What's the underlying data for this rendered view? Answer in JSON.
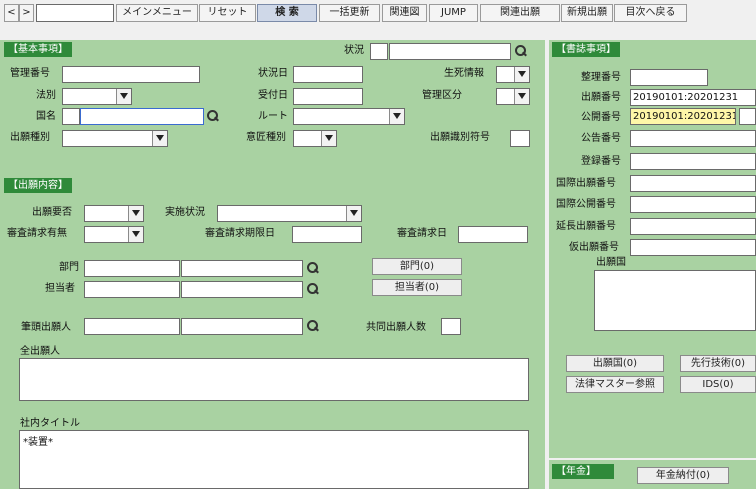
{
  "toolbar": {
    "prev": "<",
    "next": ">",
    "main_menu": "メインメニュー",
    "reset": "リセット",
    "search": "検 索",
    "bulk_update": "一括更新",
    "related_diagram": "関連図",
    "jump": "JUMP",
    "related_application": "関連出願",
    "new_application": "新規出願",
    "back_to_index": "目次へ戻る"
  },
  "basic": {
    "header": "【基本事項】",
    "status_label": "状況",
    "mgmt_no_label": "管理番号",
    "status_date_label": "状況日",
    "life_info_label": "生死情報",
    "law_label": "法別",
    "received_date_label": "受付日",
    "mgmt_class_label": "管理区分",
    "country_label": "国名",
    "route_label": "ルート",
    "app_type_label": "出願種別",
    "design_type_label": "意匠種別",
    "app_id_code_label": "出願識別符号"
  },
  "app": {
    "header": "【出願内容】",
    "app_needed_label": "出願要否",
    "impl_status_label": "実施状況",
    "exam_req_label": "審査請求有無",
    "exam_deadline_label": "審査請求期限日",
    "exam_date_label": "審査請求日",
    "dept_label": "部門",
    "dept_button": "部門(0)",
    "person_label": "担当者",
    "person_button": "担当者(0)",
    "lead_applicant_label": "筆頭出願人",
    "joint_count_label": "共同出願人数",
    "all_applicants_label": "全出願人",
    "internal_title_label": "社内タイトル",
    "internal_title_value": "*装置*"
  },
  "biblio": {
    "header": "【書誌事項】",
    "ref_no_label": "整理番号",
    "app_no_label": "出願番号",
    "app_no_value": "20190101:20201231",
    "pub_no_label": "公開番号",
    "pub_no_value": "20190101:20201231",
    "announce_no_label": "公告番号",
    "reg_no_label": "登録番号",
    "intl_app_no_label": "国際出願番号",
    "intl_pub_no_label": "国際公開番号",
    "ext_app_no_label": "延長出願番号",
    "prov_app_no_label": "仮出願番号",
    "app_country_label": "出願国",
    "app_country_button": "出願国(0)",
    "prior_art_button": "先行技術(0)",
    "law_master_button": "法律マスター参照",
    "ids_button": "IDS(0)"
  },
  "annuity": {
    "header": "【年金】",
    "paid_button": "年金納付(0)"
  }
}
